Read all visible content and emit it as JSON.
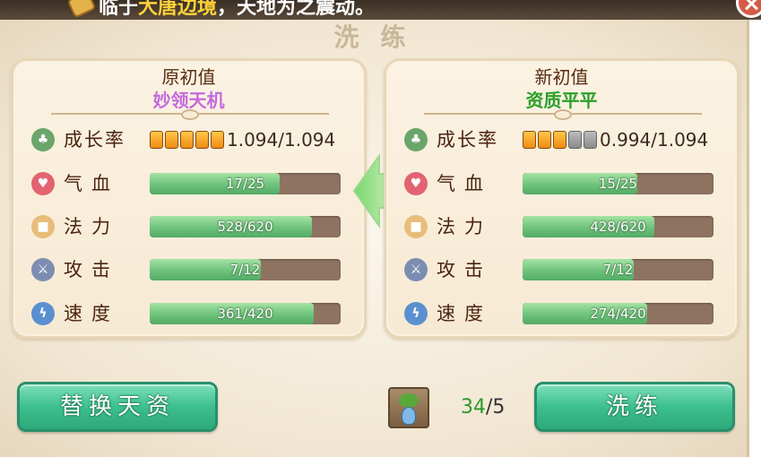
{
  "banner": {
    "text_prefix": "临于",
    "text_highlight": "大唐边境",
    "text_suffix": "，天地为之震动。"
  },
  "title": "洗练",
  "original": {
    "heading": "原初值",
    "quality": "妙领天机",
    "growth": {
      "label": "成长率",
      "value": "1.094/1.094",
      "stars_on": 5,
      "stars_total": 5
    },
    "stats": [
      {
        "icon": "heart-icon",
        "label": "气血",
        "text": "17/25",
        "current": 17,
        "max": 25
      },
      {
        "icon": "mana-icon",
        "label": "法力",
        "text": "528/620",
        "current": 528,
        "max": 620
      },
      {
        "icon": "sword-icon",
        "label": "攻击",
        "text": "7/12",
        "current": 7,
        "max": 12
      },
      {
        "icon": "lightning-icon",
        "label": "速度",
        "text": "361/420",
        "current": 361,
        "max": 420
      }
    ]
  },
  "new": {
    "heading": "新初值",
    "quality": "资质平平",
    "growth": {
      "label": "成长率",
      "value": "0.994/1.094",
      "stars_on": 3,
      "stars_total": 5
    },
    "stats": [
      {
        "icon": "heart-icon",
        "label": "气血",
        "text": "15/25",
        "current": 15,
        "max": 25
      },
      {
        "icon": "mana-icon",
        "label": "法力",
        "text": "428/620",
        "current": 428,
        "max": 620
      },
      {
        "icon": "sword-icon",
        "label": "攻击",
        "text": "7/12",
        "current": 7,
        "max": 12
      },
      {
        "icon": "lightning-icon",
        "label": "速度",
        "text": "274/420",
        "current": 274,
        "max": 420
      }
    ]
  },
  "buttons": {
    "replace": "替换天资",
    "wash": "洗练"
  },
  "item": {
    "icon": "potted-plant-icon",
    "have": "34",
    "sep": "/",
    "need": "5"
  },
  "colors": {
    "button_green": "#3cbf8e",
    "bar_fill": "#6ec27c",
    "bar_bg": "#8e7361",
    "quality_purple": "#c46ae0",
    "quality_green": "#2aa02a"
  }
}
